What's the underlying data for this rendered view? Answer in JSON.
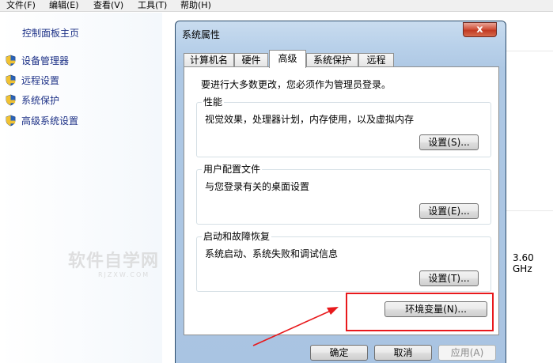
{
  "menu": [
    "文件(F)",
    "编辑(E)",
    "查看(V)",
    "工具(T)",
    "帮助(H)"
  ],
  "leftpane": {
    "home": "控制面板主页",
    "links": [
      "设备管理器",
      "远程设置",
      "系统保护",
      "高级系统设置"
    ]
  },
  "background": {
    "cpu_speed": "3.60 GHz"
  },
  "dialog": {
    "title": "系统属性",
    "close": "x",
    "tabs": [
      "计算机名",
      "硬件",
      "高级",
      "系统保护",
      "远程"
    ],
    "active_tab": "高级",
    "admin_note": "要进行大多数更改，您必须作为管理员登录。",
    "performance": {
      "title": "性能",
      "desc": "视觉效果，处理器计划，内存使用，以及虚拟内存",
      "button": "设置(S)..."
    },
    "user_profiles": {
      "title": "用户配置文件",
      "desc": "与您登录有关的桌面设置",
      "button": "设置(E)..."
    },
    "startup_recovery": {
      "title": "启动和故障恢复",
      "desc": "系统启动、系统失败和调试信息",
      "button": "设置(T)..."
    },
    "env_button": "环境变量(N)...",
    "ok": "确定",
    "cancel": "取消",
    "apply": "应用(A)"
  },
  "watermark": {
    "text": "软件自学网",
    "sub": "RJZXW.COM"
  },
  "colors": {
    "link": "#1e3287",
    "highlight": "#e8191c",
    "dialog_frame": "#b9d1ea"
  }
}
